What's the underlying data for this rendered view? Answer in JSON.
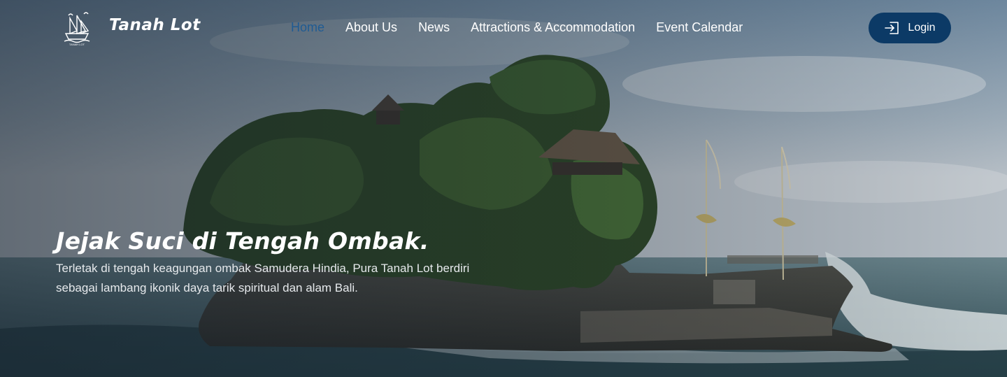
{
  "brand": {
    "name": "Tanah Lot",
    "logo_icon": "sailing-ship-icon",
    "logo_caption": "TANAH LOT"
  },
  "nav": {
    "items": [
      {
        "label": "Home",
        "active": true
      },
      {
        "label": "About Us",
        "active": false
      },
      {
        "label": "News",
        "active": false
      },
      {
        "label": "Attractions & Accommodation",
        "active": false
      },
      {
        "label": "Event Calendar",
        "active": false
      }
    ],
    "active_color": "#1f5b93"
  },
  "login": {
    "label": "Login",
    "icon": "login-arrow-icon",
    "background_color": "#0c3a66"
  },
  "hero": {
    "title": "Jejak Suci di Tengah Ombak.",
    "description": "Terletak di tengah keagungan ombak Samudera Hindia, Pura Tanah Lot berdiri sebagai lambang ikonik daya tarik spiritual dan alam Bali.",
    "background_image": "tanah-lot-temple-rock-in-ocean"
  }
}
